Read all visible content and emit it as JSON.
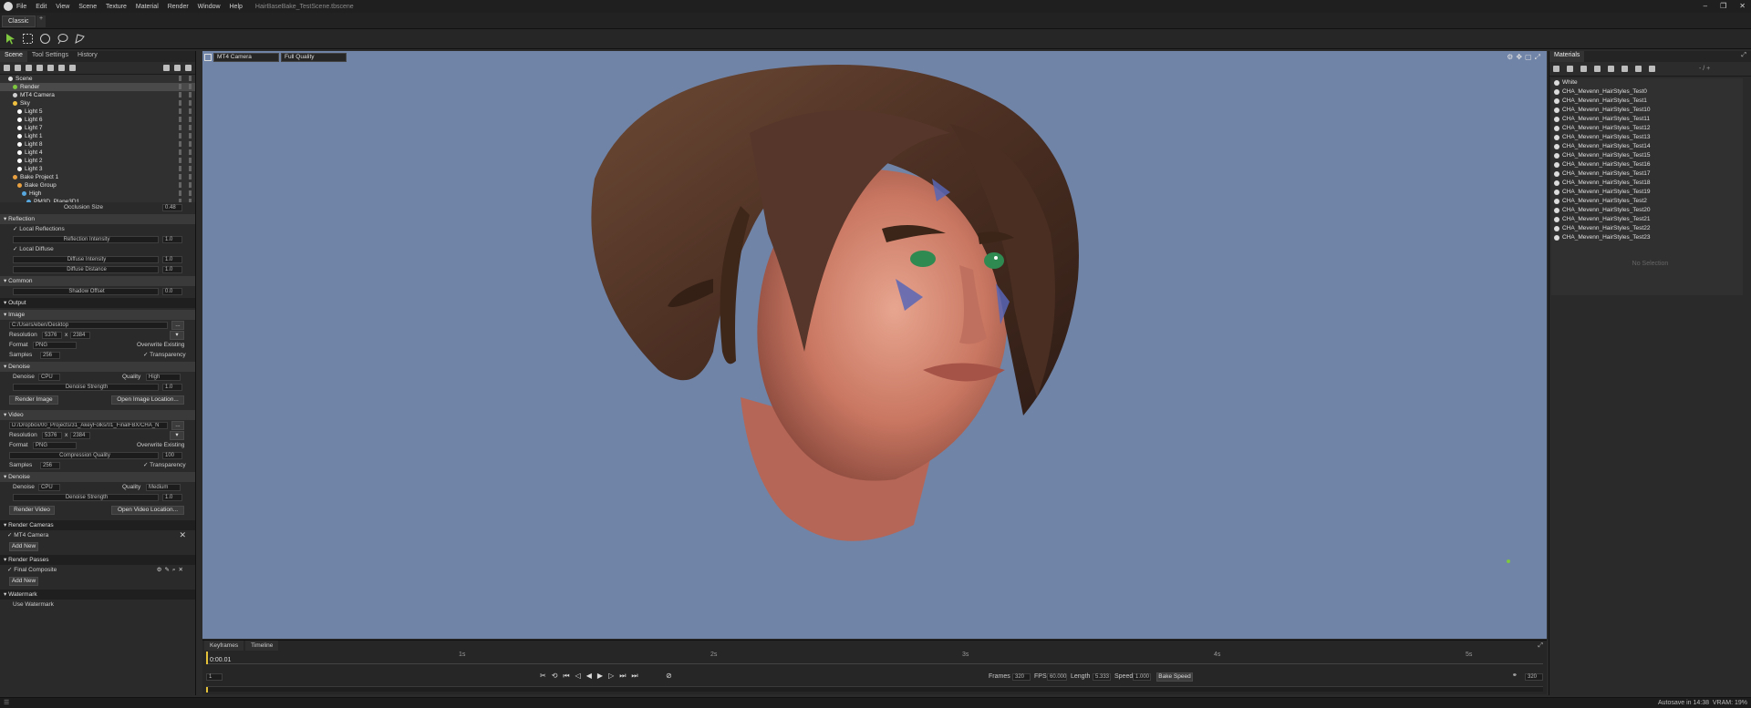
{
  "window": {
    "menu": [
      "File",
      "Edit",
      "View",
      "Scene",
      "Texture",
      "Material",
      "Render",
      "Window",
      "Help"
    ],
    "title": "HairBaseBake_TestScene.tbscene",
    "controls": [
      "–",
      "❐",
      "✕"
    ]
  },
  "workspace_tab": "Classic",
  "left_panel": {
    "tabs": [
      "Scene",
      "Tool Settings",
      "History"
    ],
    "tree": [
      {
        "label": "Scene",
        "indent": 1
      },
      {
        "label": "Render",
        "indent": 2,
        "selected": true
      },
      {
        "label": "MT4 Camera",
        "indent": 2
      },
      {
        "label": "Sky",
        "indent": 2
      },
      {
        "label": "Light 5",
        "indent": 3
      },
      {
        "label": "Light 6",
        "indent": 3
      },
      {
        "label": "Light 7",
        "indent": 3
      },
      {
        "label": "Light 1",
        "indent": 3
      },
      {
        "label": "Light 8",
        "indent": 3
      },
      {
        "label": "Light 4",
        "indent": 3
      },
      {
        "label": "Light 2",
        "indent": 3
      },
      {
        "label": "Light 3",
        "indent": 3
      },
      {
        "label": "Bake Project 1",
        "indent": 2
      },
      {
        "label": "Bake Group",
        "indent": 3
      },
      {
        "label": "High",
        "indent": 4
      },
      {
        "label": "PM3D_Plane3D1",
        "indent": 5
      }
    ],
    "occlusion_size_label": "Occlusion Size",
    "occlusion_size_value": "0.48",
    "reflection": {
      "header": "Reflection",
      "local_reflections": "Local Reflections",
      "intensity_label": "Reflection Intensity",
      "intensity_value": "1.0",
      "local_diffuse": "Local Diffuse",
      "diffuse_intensity_label": "Diffuse Intensity",
      "diffuse_intensity_value": "1.0",
      "diffuse_distance_label": "Diffuse Distance",
      "diffuse_distance_value": "1.0"
    },
    "common": {
      "header": "Common",
      "shadow_offset_label": "Shadow Offset",
      "shadow_offset_value": "0.0"
    },
    "output": {
      "header": "Output",
      "image": {
        "header": "Image",
        "path": "C:/Users/eben/Desktop",
        "browse": "...",
        "resolution_label": "Resolution",
        "res_w": "5376",
        "res_x": "x",
        "res_h": "2384",
        "format_label": "Format",
        "format_value": "PNG",
        "overwrite": "Overwrite Existing",
        "samples_label": "Samples",
        "samples_value": "256",
        "transparency": "Transparency",
        "denoise_header": "Denoise",
        "denoise_label": "Denoise",
        "denoise_value": "CPU",
        "quality_label": "Quality",
        "quality_value": "High",
        "strength_label": "Denoise Strength",
        "strength_value": "1.0",
        "render_btn": "Render Image",
        "open_btn": "Open Image Location..."
      },
      "video": {
        "header": "Video",
        "path": "D:/Dropbox/00_Projects/31_AkeyFolks/01_FinalFBX/CHA_N",
        "browse": "...",
        "resolution_label": "Resolution",
        "res_w": "5376",
        "res_x": "x",
        "res_h": "2384",
        "format_label": "Format",
        "format_value": "PNG",
        "overwrite": "Overwrite Existing",
        "compression_label": "Compression Quality",
        "compression_value": "100",
        "samples_label": "Samples",
        "samples_value": "256",
        "transparency": "Transparency",
        "denoise_header": "Denoise",
        "denoise_label": "Denoise",
        "denoise_value": "CPU",
        "quality_label": "Quality",
        "quality_value": "Medium",
        "strength_label": "Denoise Strength",
        "strength_value": "1.0",
        "render_btn": "Render Video",
        "open_btn": "Open Video Location..."
      }
    },
    "render_cameras": {
      "header": "Render Cameras",
      "item": "MT4 Camera",
      "add": "Add New"
    },
    "render_passes": {
      "header": "Render Passes",
      "item": "Final Composite",
      "add": "Add New"
    },
    "watermark": {
      "header": "Watermark",
      "item": "Use Watermark"
    }
  },
  "viewport": {
    "camera": "MT4 Camera",
    "quality": "Full Quality"
  },
  "timeline": {
    "tabs": [
      "Keyframes",
      "Timeline"
    ],
    "time": "0:00.01",
    "ticks": [
      "1s",
      "2s",
      "3s",
      "4s",
      "5s"
    ],
    "frame": "1",
    "frames_label": "Frames",
    "frames_value": "320",
    "fps_label": "FPS",
    "fps_value": "60.000",
    "length_label": "Length",
    "length_value": "5.333",
    "speed_label": "Speed",
    "speed_value": "1.000",
    "bake_speed": "Bake Speed",
    "end_frame": "320"
  },
  "materials": {
    "header": "Materials",
    "filter": "- / +",
    "items": [
      "White",
      "CHA_Mevenn_HairStyles_Test0",
      "CHA_Mevenn_HairStyles_Test1",
      "CHA_Mevenn_HairStyles_Test10",
      "CHA_Mevenn_HairStyles_Test11",
      "CHA_Mevenn_HairStyles_Test12",
      "CHA_Mevenn_HairStyles_Test13",
      "CHA_Mevenn_HairStyles_Test14",
      "CHA_Mevenn_HairStyles_Test15",
      "CHA_Mevenn_HairStyles_Test16",
      "CHA_Mevenn_HairStyles_Test17",
      "CHA_Mevenn_HairStyles_Test18",
      "CHA_Mevenn_HairStyles_Test19",
      "CHA_Mevenn_HairStyles_Test2",
      "CHA_Mevenn_HairStyles_Test20",
      "CHA_Mevenn_HairStyles_Test21",
      "CHA_Mevenn_HairStyles_Test22",
      "CHA_Mevenn_HairStyles_Test23"
    ],
    "no_selection": "No Selection"
  },
  "status": {
    "autosave": "Autosave in 14:38",
    "vram": "VRAM: 19%"
  },
  "colors": {
    "viewport_bg": "#7084a8",
    "accent_green": "#7ec73f",
    "playhead": "#e3c23a"
  }
}
